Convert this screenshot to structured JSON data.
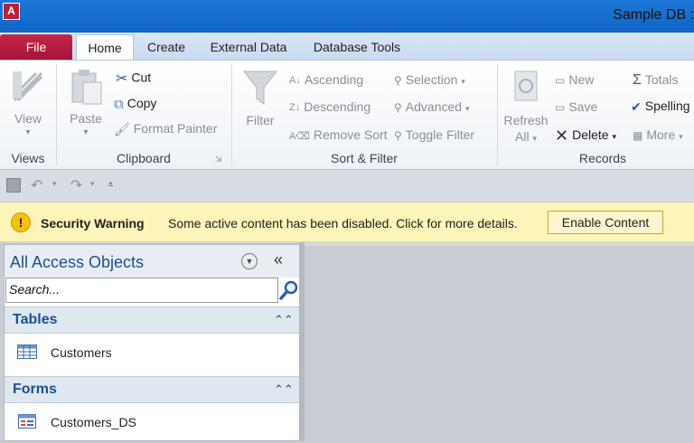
{
  "titlebar": {
    "app_icon_glyph": "A",
    "title": "Sample DB :"
  },
  "tabs": [
    {
      "label": "File"
    },
    {
      "label": "Home"
    },
    {
      "label": "Create"
    },
    {
      "label": "External Data"
    },
    {
      "label": "Database Tools"
    }
  ],
  "ribbon": {
    "views": {
      "view_label": "View",
      "group_label": "Views"
    },
    "clipboard": {
      "paste_label": "Paste",
      "cut_label": "Cut",
      "copy_label": "Copy",
      "format_painter_label": "Format Painter",
      "group_label": "Clipboard"
    },
    "sort_filter": {
      "filter_label": "Filter",
      "ascending_label": "Ascending",
      "descending_label": "Descending",
      "remove_sort_label": "Remove Sort",
      "selection_label": "Selection",
      "advanced_label": "Advanced",
      "toggle_filter_label": "Toggle Filter",
      "group_label": "Sort & Filter"
    },
    "records": {
      "refresh_label": "Refresh",
      "refresh_all_label": "All",
      "new_label": "New",
      "save_label": "Save",
      "delete_label": "Delete",
      "totals_label": "Totals",
      "spelling_label": "Spelling",
      "more_label": "More",
      "group_label": "Records"
    }
  },
  "security_bar": {
    "title": "Security Warning",
    "message": "Some active content has been disabled. Click for more details.",
    "button_label": "Enable Content",
    "icon_glyph": "!"
  },
  "nav_pane": {
    "title": "All Access Objects",
    "search_placeholder": "Search...",
    "sections": [
      {
        "title": "Tables",
        "items": [
          {
            "label": "Customers",
            "icon": "table-icon"
          }
        ]
      },
      {
        "title": "Forms",
        "items": [
          {
            "label": "Customers_DS",
            "icon": "form-icon"
          }
        ]
      }
    ]
  },
  "colors": {
    "titlebar": "#1e78d8",
    "file_tab": "#b81d45",
    "security_bar": "#fcf4b8",
    "nav_heading": "#1e4f8f"
  }
}
